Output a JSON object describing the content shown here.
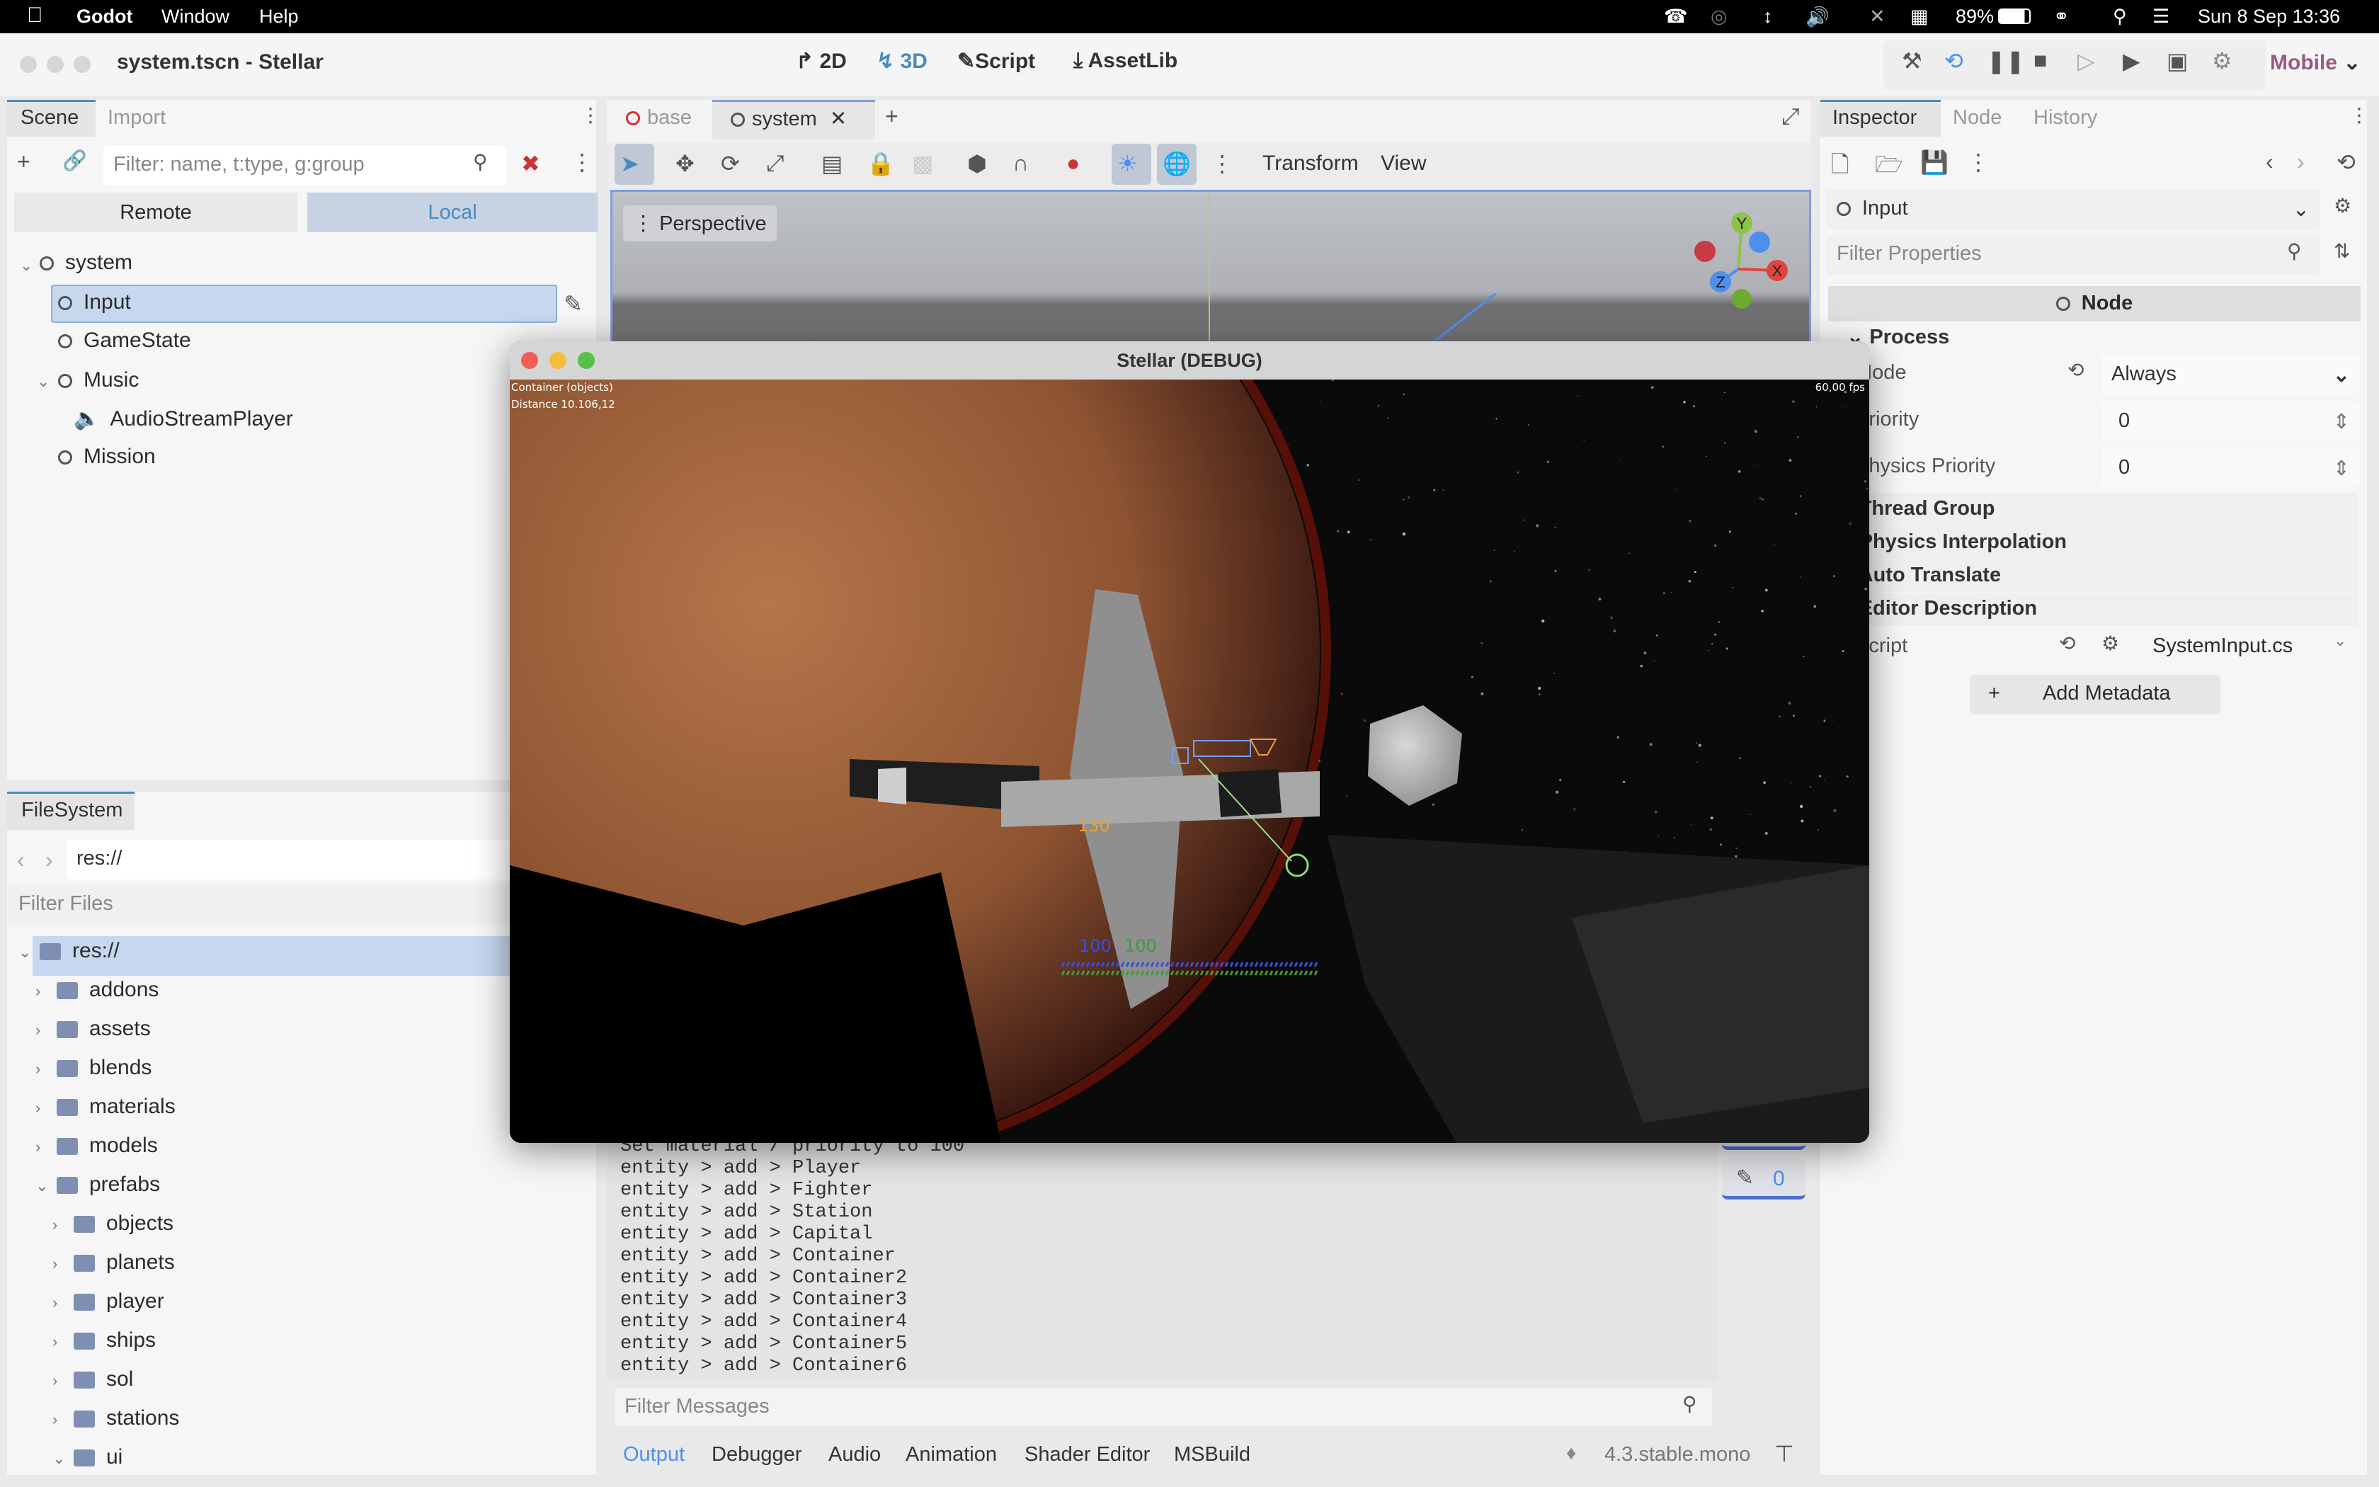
{
  "menubar": {
    "app": "Godot",
    "items": [
      "Window",
      "Help"
    ],
    "battery": "89%",
    "datetime": "Sun 8 Sep  13:36"
  },
  "titlebar": {
    "title": "system.tscn - Stellar",
    "modes": [
      "2D",
      "3D",
      "Script",
      "AssetLib"
    ],
    "active_mode": "3D",
    "renderer": "Mobile",
    "accent": "#478cbf",
    "renderer_color": "#9b5a7d"
  },
  "scene_dock": {
    "tabs": [
      "Scene",
      "Import"
    ],
    "filter_placeholder": "Filter: name, t:type, g:group",
    "remote": "Remote",
    "local": "Local",
    "tree": [
      {
        "label": "system"
      },
      {
        "label": "Input",
        "selected": true
      },
      {
        "label": "GameState"
      },
      {
        "label": "Music"
      },
      {
        "label": "AudioStreamPlayer",
        "icon": "speaker-icon"
      },
      {
        "label": "Mission"
      }
    ]
  },
  "filesystem": {
    "tab": "FileSystem",
    "path": "res://",
    "filter_placeholder": "Filter Files",
    "items": [
      "res://",
      "addons",
      "assets",
      "blends",
      "materials",
      "models",
      "prefabs",
      "objects",
      "planets",
      "player",
      "ships",
      "sol",
      "stations",
      "ui"
    ]
  },
  "editor": {
    "tabs": [
      "base",
      "system"
    ],
    "toolbar_menus": [
      "Transform",
      "View"
    ],
    "viewport_label": "Perspective",
    "gizmo_axes": [
      "Y",
      "X",
      "Z"
    ]
  },
  "output": {
    "lines": [
      "Set material / priority to 100",
      "entity > add > Player",
      "entity > add > Fighter",
      "entity > add > Station",
      "entity > add > Capital",
      "entity > add > Container",
      "entity > add > Container2",
      "entity > add > Container3",
      "entity > add > Container4",
      "entity > add > Container5",
      "entity > add > Container6"
    ],
    "filter_placeholder": "Filter Messages",
    "warning_count": "0",
    "bottom_tabs": [
      "Output",
      "Debugger",
      "Audio",
      "Animation",
      "Shader Editor",
      "MSBuild"
    ],
    "version": "4.3.stable.mono"
  },
  "inspector": {
    "tabs": [
      "Inspector",
      "Node",
      "History"
    ],
    "object": "Input",
    "filter_placeholder": "Filter Properties",
    "class_header": "Node",
    "sections": {
      "process": "Process",
      "thread_group": "Thread Group",
      "physics_interp": "Physics Interpolation",
      "auto_translate": "Auto Translate",
      "editor_desc": "Editor Description"
    },
    "props": {
      "mode_label": "Mode",
      "mode_value": "Always",
      "priority_label": "Priority",
      "priority_value": "0",
      "phys_label": "Physics Priority",
      "phys_value": "0",
      "script_label": "Script",
      "script_value": "SystemInput.cs"
    },
    "add_metadata": "Add Metadata"
  },
  "game": {
    "title": "Stellar (DEBUG)",
    "target": "Container (objects)",
    "distance": "Distance 10.106,12",
    "fps": "60,00 fps",
    "speed": "130",
    "shield": "100",
    "hull": "100",
    "shield_color": "#3a4fe0",
    "hull_color": "#3f9a3f",
    "speed_color": "#e8a23a"
  }
}
